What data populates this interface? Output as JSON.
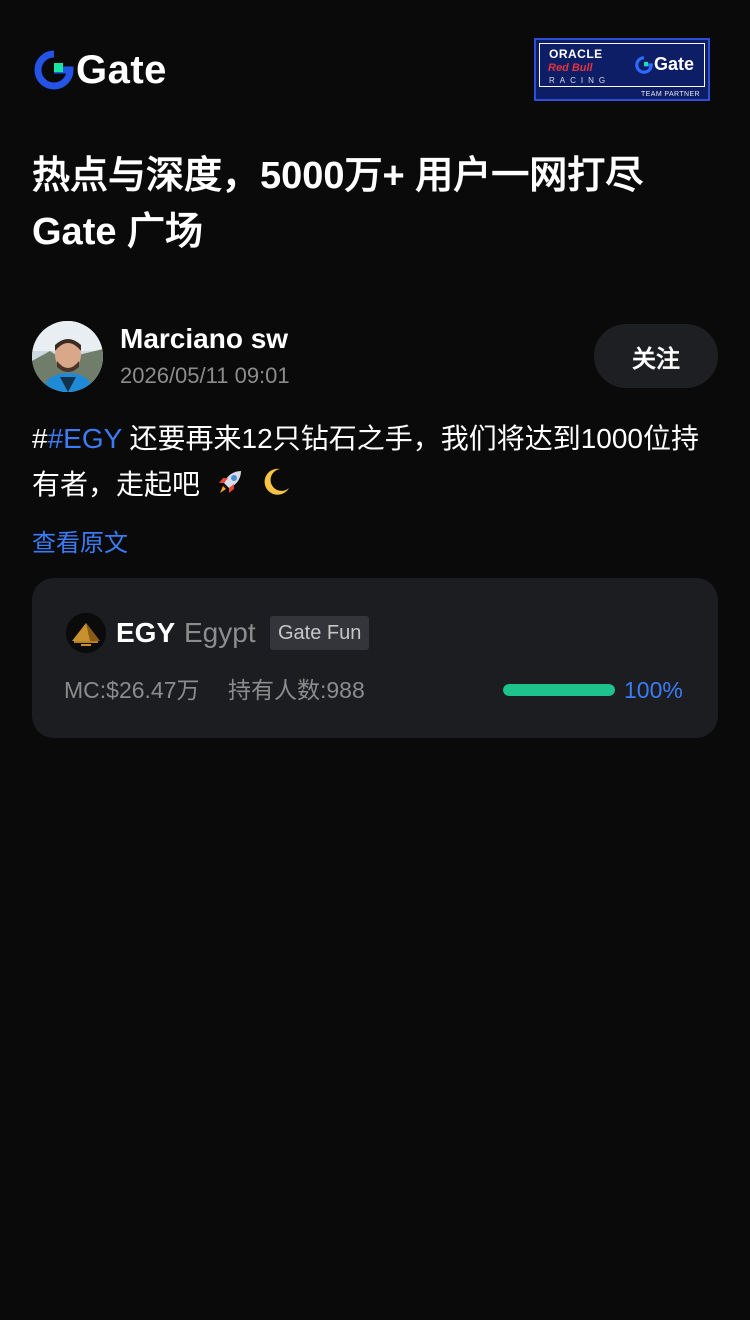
{
  "header": {
    "logo_text": "Gate",
    "partner_badge": {
      "oracle": "ORACLE",
      "redbull": "Red Bull",
      "racing": "RACING",
      "gate": "Gate",
      "team_partner": "TEAM PARTNER"
    }
  },
  "headline": {
    "line1": "热点与深度，5000万+ 用户一网打尽",
    "line2": "Gate 广场"
  },
  "post": {
    "author": "Marciano sw",
    "time": "2026/05/11 09:01",
    "follow_label": "关注",
    "hash_prefix": "#",
    "hashtag": "#EGY",
    "text": " 还要再来12只钻石之手，我们将达到1000位持有者，走起吧",
    "emojis": [
      "rocket-icon",
      "crescent-moon-icon"
    ],
    "view_original": "查看原文"
  },
  "token": {
    "symbol": "EGY",
    "name": "Egypt",
    "tag": "Gate Fun",
    "market_cap": "MC:$26.47万",
    "holders": "持有人数:988",
    "progress_label": "100%",
    "progress": 1.0,
    "colors": {
      "progress": "#1ec28b",
      "accent": "#3b7cf5"
    }
  },
  "colors": {
    "background": "#0a0a0a",
    "card": "#1b1d21",
    "link": "#3b7cf5",
    "muted": "#8c8c8c"
  }
}
